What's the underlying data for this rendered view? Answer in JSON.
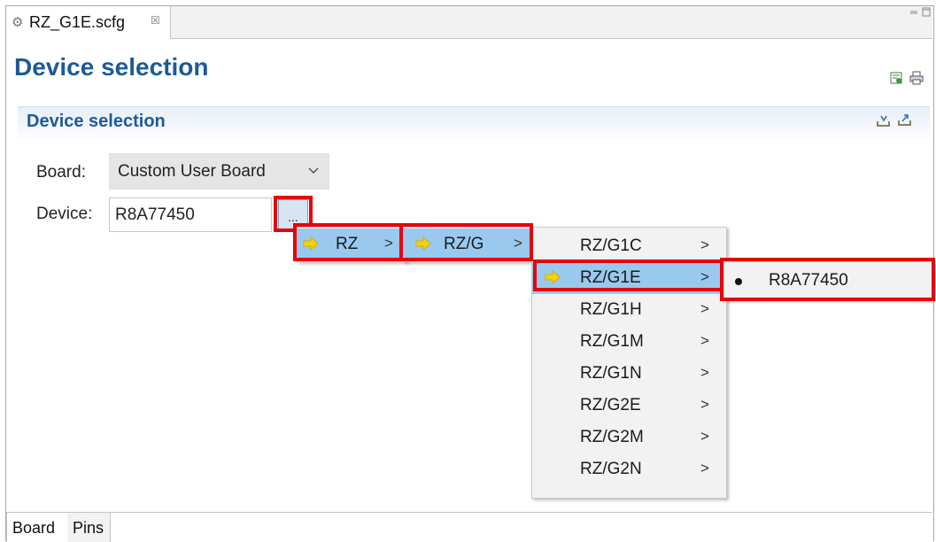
{
  "editor_tab": {
    "filename": "RZ_G1E.scfg",
    "close_glyph": "☒"
  },
  "window_controls": {
    "minimize_glyph": "▭",
    "maximize_glyph": "▭"
  },
  "page_title": "Device selection",
  "header_icons": [
    "generate-code-icon",
    "print-icon"
  ],
  "section": {
    "title": "Device selection",
    "icons": [
      "import-icon",
      "export-icon"
    ]
  },
  "form": {
    "board_label": "Board:",
    "board_value": "Custom User Board",
    "device_label": "Device:",
    "device_value": "R8A77450",
    "browse_label": "..."
  },
  "menus": {
    "level1": [
      {
        "label": "RZ",
        "highlighted": true
      }
    ],
    "level2": [
      {
        "label": "RZ/G",
        "highlighted": true
      }
    ],
    "level3": [
      {
        "label": "RZ/G1C",
        "highlighted": false
      },
      {
        "label": "RZ/G1E",
        "highlighted": true
      },
      {
        "label": "RZ/G1H",
        "highlighted": false
      },
      {
        "label": "RZ/G1M",
        "highlighted": false
      },
      {
        "label": "RZ/G1N",
        "highlighted": false
      },
      {
        "label": "RZ/G2E",
        "highlighted": false
      },
      {
        "label": "RZ/G2M",
        "highlighted": false
      },
      {
        "label": "RZ/G2N",
        "highlighted": false
      }
    ],
    "level4": [
      {
        "label": "R8A77450",
        "selected": true
      }
    ],
    "submenu_arrow": ">"
  },
  "bottom_tabs": [
    {
      "label": "Board",
      "active": true
    },
    {
      "label": "Pins",
      "active": false
    }
  ],
  "colors": {
    "title_blue": "#1e5a96",
    "menu_highlight": "#99c9ef",
    "callout_red": "#e8000b",
    "arrow_yellow": "#f5d400"
  }
}
